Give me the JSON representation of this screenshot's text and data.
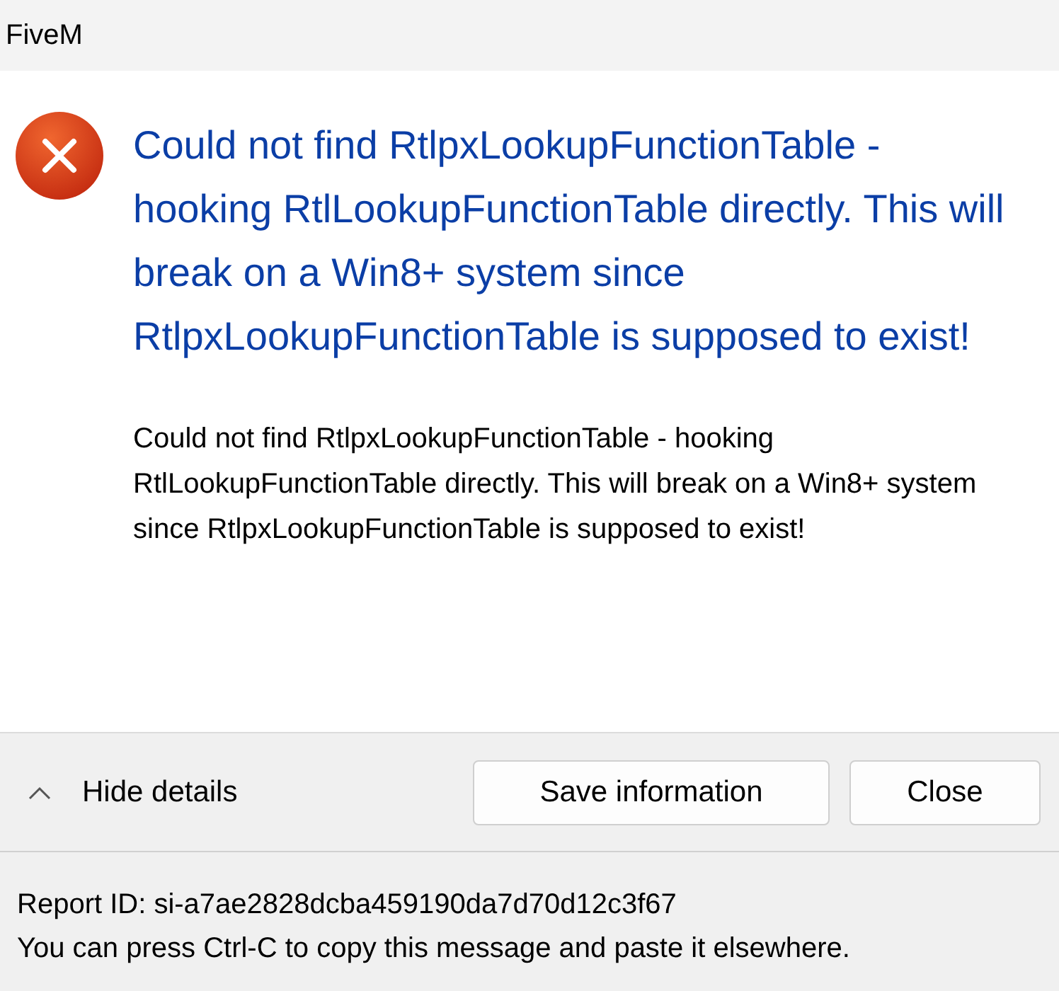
{
  "window": {
    "title": "FiveM"
  },
  "icon": {
    "kind": "error"
  },
  "main_instruction": "Could not find RtlpxLookupFunctionTable - hooking RtlLookupFunctionTable directly. This will break on a Win8+ system since RtlpxLookupFunctionTable is supposed to exist!",
  "content": "Could not find RtlpxLookupFunctionTable - hooking RtlLookupFunctionTable directly. This will break on a Win8+ system since RtlpxLookupFunctionTable is supposed to exist!",
  "details_toggle": {
    "label": "Hide details",
    "expanded": true
  },
  "buttons": [
    "Save information",
    "Close"
  ],
  "footer": [
    "Report ID: si-a7ae2828dcba459190da7d70d12c3f67",
    "You can press Ctrl-C to copy this message and paste it elsewhere."
  ]
}
